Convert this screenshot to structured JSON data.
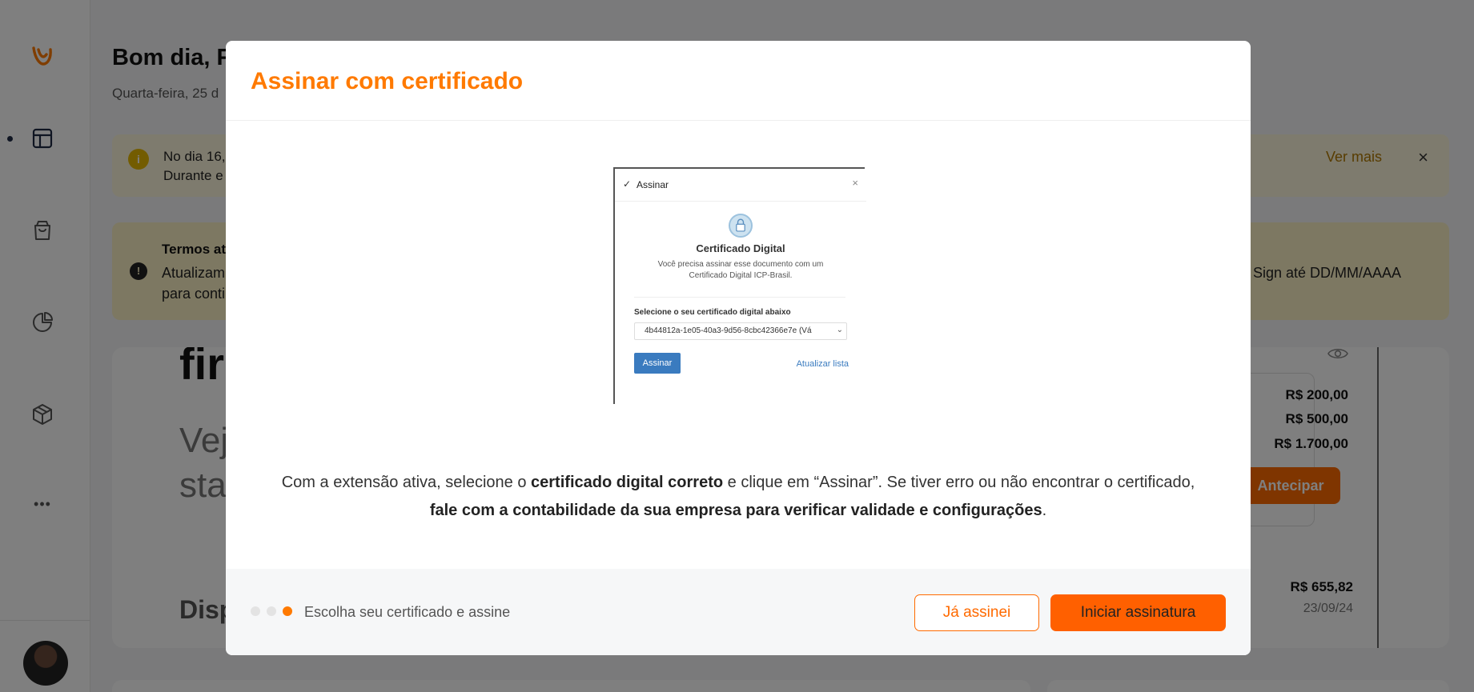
{
  "sidebar": {
    "items": [
      {
        "icon": "layout-icon"
      },
      {
        "icon": "shopping-bag-icon"
      },
      {
        "icon": "pie-chart-icon"
      },
      {
        "icon": "box-icon"
      },
      {
        "icon": "more-icon"
      }
    ],
    "more_label": "•••"
  },
  "background": {
    "greeting": "Bom dia, F",
    "date": "Quarta-feira, 25 d",
    "notice": {
      "line1": "No dia 16,",
      "line2": "Durante e",
      "more": "Ver mais",
      "close": "×"
    },
    "terms": {
      "title": "Termos at",
      "line1": "Atualizam",
      "line2": "para conti",
      "right_text": "Sign até DD/MM/AAAA"
    },
    "card": {
      "big": "fir",
      "sub1": "Vej",
      "sub2": "sta",
      "disp": "Disp",
      "values": [
        "R$ 200,00",
        "R$ 500,00",
        "R$ 1.700,00"
      ],
      "antecipar": "Antecipar",
      "value2": "R$ 655,82",
      "date2": "23/09/24"
    }
  },
  "modal": {
    "title": "Assinar com certificado",
    "screenshot": {
      "header": "Assinar",
      "close": "×",
      "heading": "Certificado Digital",
      "text1": "Você precisa assinar esse documento com um",
      "text2": "Certificado Digital ICP-Brasil.",
      "select_label": "Selecione o seu certificado digital abaixo",
      "select_value": "4b44812a-1e05-40a3-9d56-8cbc42366e7e (Vá",
      "button": "Assinar",
      "link": "Atualizar lista"
    },
    "description": {
      "p1": "Com a extensão ativa, selecione o ",
      "b1": "certificado digital correto",
      "p2": " e clique em “Assinar”. Se tiver erro ou não encontrar o certificado,",
      "b2": "fale com a contabilidade da sua empresa para verificar validade e configurações",
      "p3": "."
    },
    "footer": {
      "step_label": "Escolha seu certificado e assine",
      "steps_total": 3,
      "current_step": 3,
      "secondary_button": "Já assinei",
      "primary_button": "Iniciar assinatura"
    }
  },
  "colors": {
    "accent": "#ff7a00",
    "primary_button": "#ff6000"
  }
}
